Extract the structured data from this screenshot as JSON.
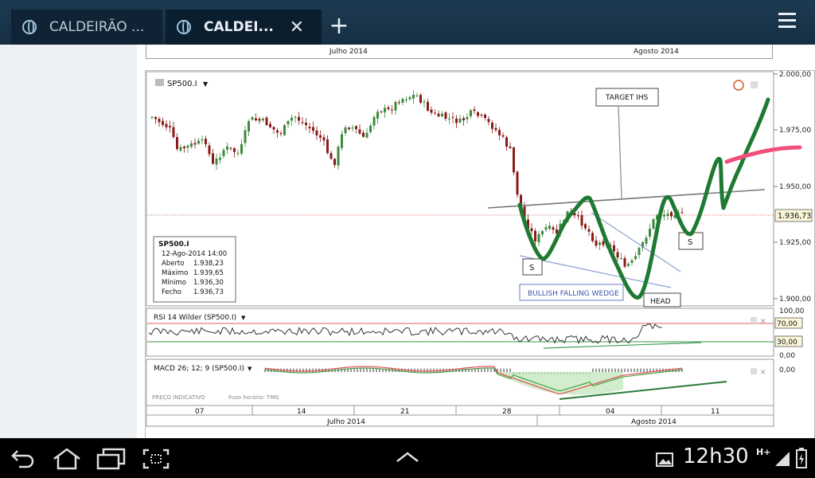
{
  "tabs": [
    {
      "label": "CALDEIRÃO ..."
    },
    {
      "label": "CALDEI..."
    }
  ],
  "top_axis": {
    "month1": "Julho 2014",
    "month2": "Agosto 2014"
  },
  "chart": {
    "symbol": "SP500.I",
    "price_labels": [
      "2.000,00",
      "1.975,00",
      "1.950,00",
      "1.925,00",
      "1.900,00"
    ],
    "last_price": "1.936,73",
    "annotations": {
      "target": "TARGET IHS",
      "shoulder_left": "S",
      "shoulder_right": "S",
      "head": "HEAD",
      "wedge": "BULLISH FALLING WEDGE"
    },
    "info_box": {
      "title": "SP500.I",
      "date": "12-Ago-2014 14:00",
      "rows": [
        {
          "label": "Aberto",
          "value": "1.938,23"
        },
        {
          "label": "Máximo",
          "value": "1.939,65"
        },
        {
          "label": "Mínimo",
          "value": "1.936,30"
        },
        {
          "label": "Fecho",
          "value": "1.936,73"
        }
      ]
    },
    "rsi": {
      "title": "RSI 14 Wilder (SP500.I)",
      "levels": [
        "100,00",
        "70,00",
        "30,00",
        "0,00"
      ]
    },
    "macd": {
      "title": "MACD 26; 12; 9 (SP500.I)",
      "zero": "0,00",
      "note": "PREÇO INDICATIVO",
      "tz": "Fuso horário: TMG"
    },
    "x_axis": {
      "days": [
        "07",
        "14",
        "21",
        "28",
        "04",
        "11"
      ],
      "month1": "Julho 2014",
      "month2": "Agosto 2014"
    },
    "colors": {
      "up": "#3d8a3d",
      "down": "#8b1a1a",
      "drawing": "#1e7a32",
      "target_line": "#f0507a"
    }
  },
  "status": {
    "time": "12h30",
    "network": "H+"
  }
}
